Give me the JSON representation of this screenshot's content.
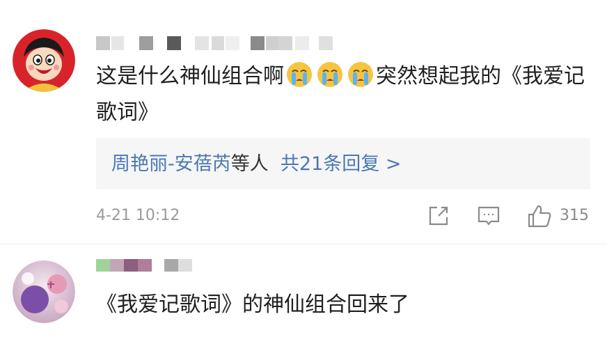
{
  "comments": [
    {
      "text_before": "这是什么神仙组合啊",
      "emojis": [
        "crying-emoji",
        "crying-emoji",
        "crying-emoji"
      ],
      "text_after": "突然想起我的《我爱记歌词》",
      "replies": {
        "names": "周艳丽-安蓓芮",
        "others": "等人",
        "count_text": "共21条回复 >"
      },
      "time": "4-21 10:12",
      "likes": "315"
    },
    {
      "name_partial": "快乐党员",
      "text": "《我爱记歌词》的神仙组合回来了"
    }
  ],
  "colors": {
    "link": "#4a78b3",
    "meta": "#9a9a9a",
    "reply_bg": "#f6f6f6"
  },
  "icons": [
    "share-icon",
    "comment-icon",
    "like-icon"
  ]
}
